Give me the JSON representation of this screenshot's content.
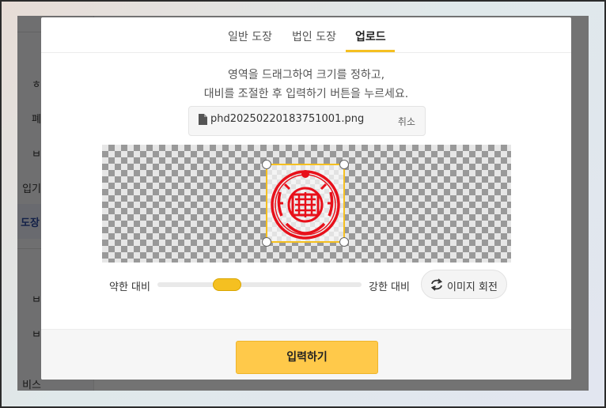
{
  "background_page": {
    "sidebar_items": [
      "ㅎ",
      "폐",
      "ㅂ",
      "입기",
      "ㅂ",
      "ㅂ",
      "비스"
    ],
    "active_item": "도장"
  },
  "tabs": [
    {
      "label": "일반 도장",
      "active": false
    },
    {
      "label": "법인 도장",
      "active": false
    },
    {
      "label": "업로드",
      "active": true
    }
  ],
  "instructions": {
    "line1": "영역을 드래그하여 크기를 정하고,",
    "line2": "대비를 조절한 후 입력하기 버튼을 누르세요."
  },
  "file": {
    "icon": "file-icon",
    "name": "phd20250220183751001.png",
    "cancel_label": "취소"
  },
  "contrast": {
    "low_label": "약한 대비",
    "high_label": "강한 대비",
    "value_fraction": 0.34
  },
  "rotate": {
    "icon": "rotate-icon",
    "label": "이미지 회전"
  },
  "submit": {
    "label": "입력하기"
  },
  "colors": {
    "accent": "#f5c021",
    "submit_bg": "#ffc94a",
    "stamp_red": "#e8101a"
  }
}
